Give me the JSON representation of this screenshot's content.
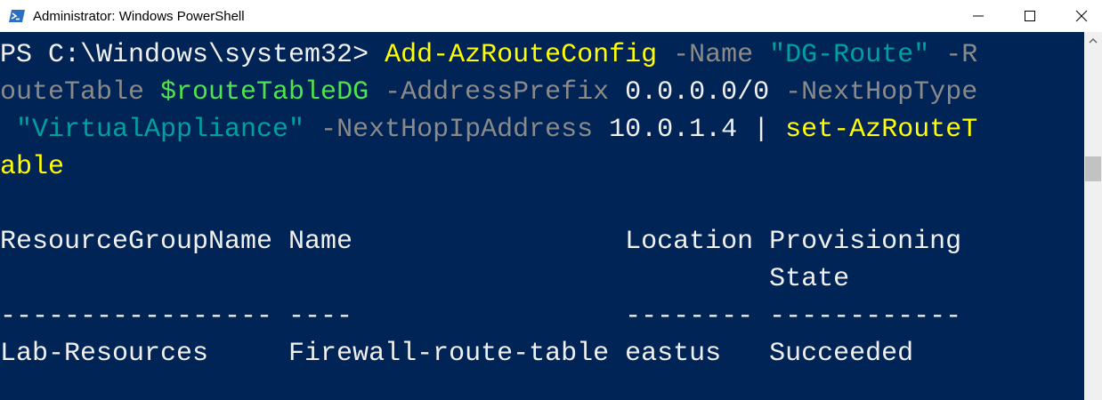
{
  "window": {
    "title": "Administrator: Windows PowerShell",
    "icon": "powershell-icon"
  },
  "controls": {
    "minimize_icon": "minimize-icon",
    "maximize_icon": "maximize-icon",
    "close_icon": "close-icon"
  },
  "colors": {
    "console_background": "#012456",
    "command": "#ffff00",
    "parameter": "#8a8a8a",
    "string": "#00a0a0",
    "variable": "#4fe34f",
    "default": "#f0f0f0"
  },
  "console": {
    "line1": {
      "prompt": "PS C:\\Windows\\system32> ",
      "cmd": "Add-AzRouteConfig",
      "p_name": " -Name ",
      "s_name": "\"DG-Route\"",
      "p_rt": " -R"
    },
    "line2": {
      "p_rt": "outeTable ",
      "var": "$routeTableDG",
      "p_addr": " -AddressPrefix ",
      "addr": "0.0.0.0/0",
      "p_nht": " -NextHopType"
    },
    "line3": {
      "s_va": " \"VirtualAppliance\"",
      "p_nhip": " -NextHopIpAddress ",
      "ip": "10.0.1.4",
      "pipe": " | ",
      "cmd": "set-AzRouteT"
    },
    "line4": {
      "cmd": "able"
    },
    "table": {
      "header_line1": "ResourceGroupName Name                 Location Provisioning",
      "header_line2": "                                                State",
      "separator": "----------------- ----                 -------- ------------",
      "row1": "Lab-Resources     Firewall-route-table eastus   Succeeded"
    }
  }
}
